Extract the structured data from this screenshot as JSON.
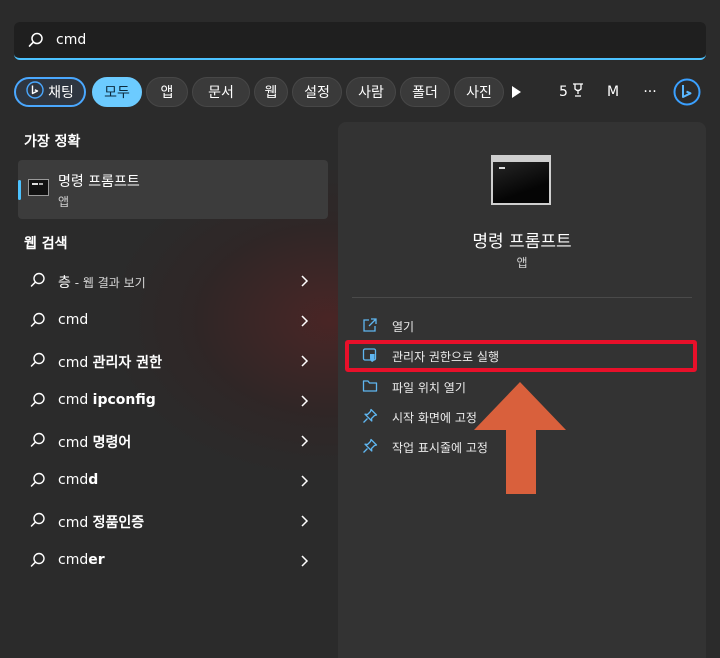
{
  "search": {
    "value": "cmd"
  },
  "filters": {
    "chat_label": "채팅",
    "items": [
      "모두",
      "앱",
      "문서",
      "웹",
      "설정",
      "사람",
      "폴더",
      "사진"
    ],
    "points": "5",
    "avatar_initial": "M",
    "more": "···"
  },
  "best_match": {
    "heading": "가장 정확",
    "name": "명령 프롬프트",
    "type": "앱"
  },
  "web_search": {
    "heading": "웹 검색",
    "items": [
      {
        "main": "층",
        "suffix": " - 웹 결과 보기"
      },
      {
        "main": "cmd",
        "suffix": ""
      },
      {
        "main": "cmd ",
        "bold": "관리자 권한"
      },
      {
        "main": "cmd ",
        "bold": "ipconfig"
      },
      {
        "main": "cmd ",
        "bold": "명령어"
      },
      {
        "main": "cmd",
        "bold": "d"
      },
      {
        "main": "cmd ",
        "bold": "정품인증"
      },
      {
        "main": "cmd",
        "bold": "er"
      }
    ]
  },
  "detail": {
    "title": "명령 프롬프트",
    "subtitle": "앱",
    "actions": [
      "열기",
      "관리자 권한으로 실행",
      "파일 위치 열기",
      "시작 화면에 고정",
      "작업 표시줄에 고정"
    ]
  },
  "colors": {
    "accent": "#4cc2ff",
    "highlight": "#e8102a",
    "arrow": "#d9603c"
  }
}
